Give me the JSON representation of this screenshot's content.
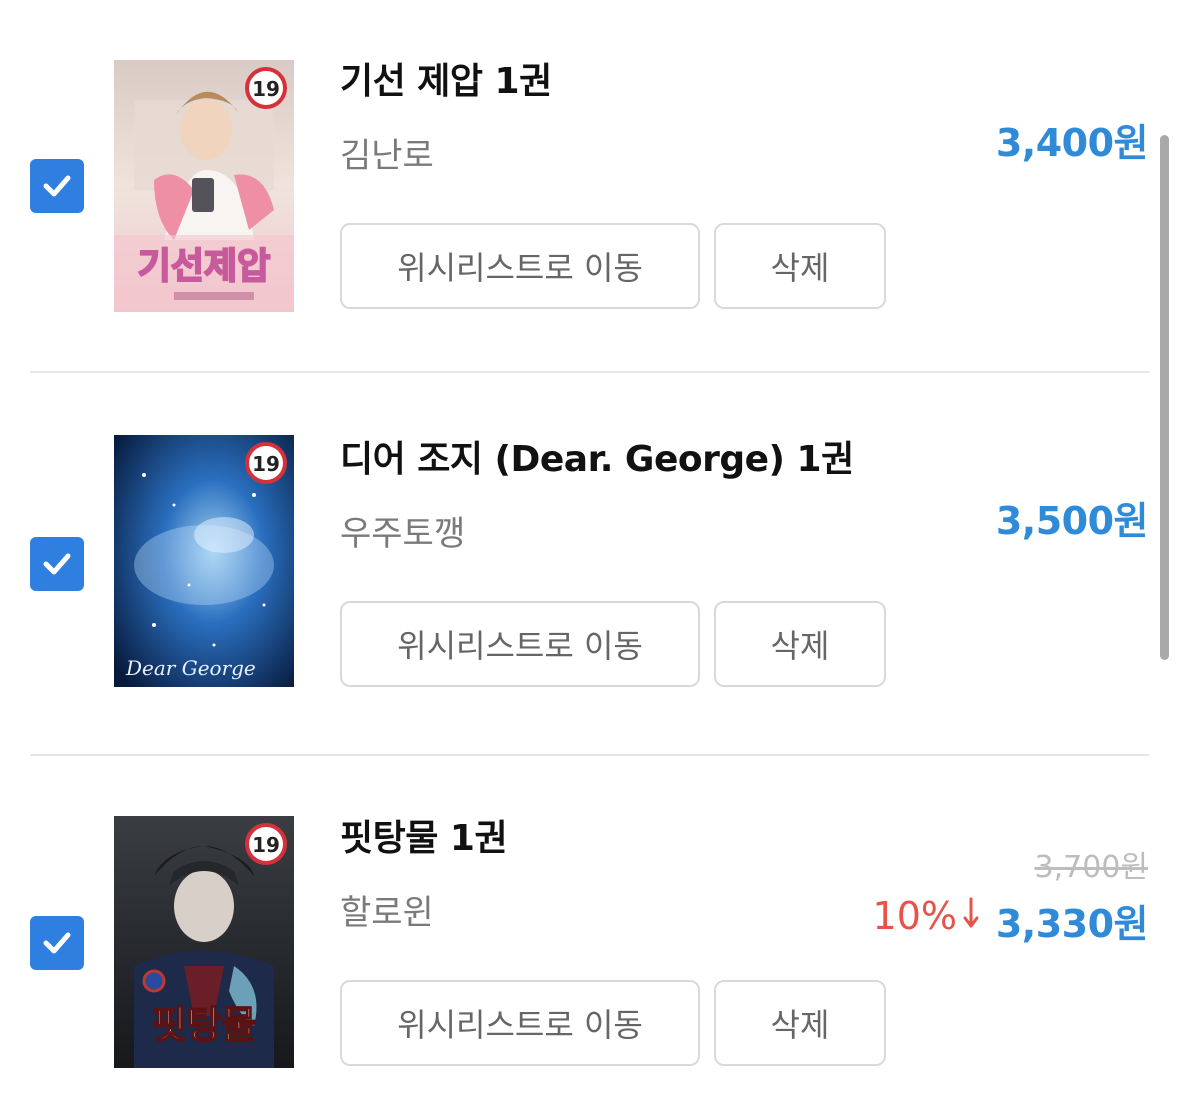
{
  "items": [
    {
      "title": "기선 제압 1권",
      "author": "김난로",
      "price": "3,400원",
      "checked": true,
      "cover_badge": "19",
      "cover_logo_text": "기선제압",
      "buttons": {
        "wishlist": "위시리스트로 이동",
        "delete": "삭제"
      }
    },
    {
      "title": "디어 조지 (Dear. George) 1권",
      "author": "우주토깽",
      "price": "3,500원",
      "checked": true,
      "cover_badge": "19",
      "cover_logo_text": "Dear George",
      "buttons": {
        "wishlist": "위시리스트로 이동",
        "delete": "삭제"
      }
    },
    {
      "title": "핏탕물 1권",
      "author": "할로윈",
      "original_price": "3,700원",
      "discount": "10%",
      "price": "3,330원",
      "checked": true,
      "cover_badge": "19",
      "cover_logo_text": "핏탕물",
      "buttons": {
        "wishlist": "위시리스트로 이동",
        "delete": "삭제"
      }
    }
  ],
  "colors": {
    "checkbox": "#2f7fe0",
    "price": "#2f8ad8",
    "discount": "#e8524a",
    "title": "#111111",
    "author": "#7a7a7a",
    "button_border": "#d9d9d9"
  },
  "icons": {
    "checkbox": "check-icon",
    "discount_arrow": "arrow-down-icon",
    "badge": "age-19-badge"
  }
}
